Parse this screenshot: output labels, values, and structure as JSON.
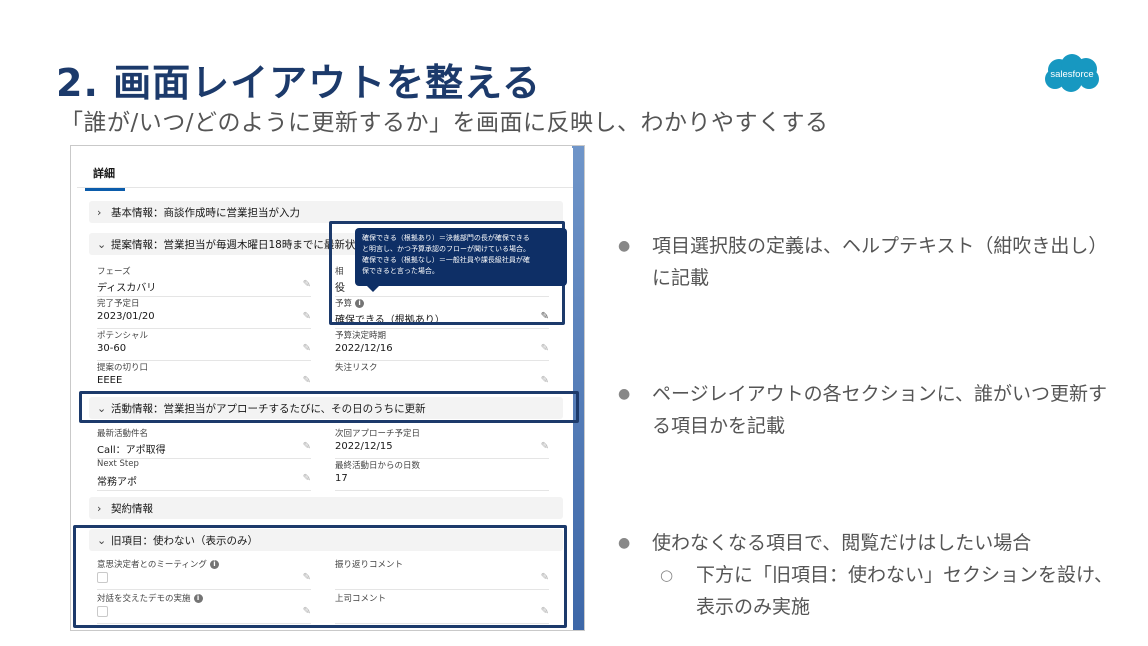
{
  "slide": {
    "title": "2. 画面レイアウトを整える",
    "subtitle": "「誰が/いつ/どのように更新するか」を画面に反映し、わかりやすくする",
    "logo_text": "salesforce"
  },
  "screen": {
    "tab": "詳細",
    "sections": {
      "basic": "基本情報：商談作成時に営業担当が入力",
      "proposal": "提案情報：営業担当が毎週木曜日18時までに最新状",
      "activity": "活動情報：営業担当がアプローチするたびに、その日のうちに更新",
      "contract": "契約情報",
      "legacy": "旧項目：使わない（表示のみ）"
    },
    "proposal_fields": [
      {
        "label": "フェーズ",
        "value": "ディスカバリ"
      },
      {
        "label": "相",
        "value": "役"
      },
      {
        "label": "完了予定日",
        "value": "2023/01/20"
      },
      {
        "label": "予算",
        "value": "確保できる（根拠あり）"
      },
      {
        "label": "ポテンシャル",
        "value": "30-60"
      },
      {
        "label": "予算決定時期",
        "value": "2022/12/16"
      },
      {
        "label": "提案の切り口",
        "value": "EEEE"
      },
      {
        "label": "失注リスク",
        "value": ""
      }
    ],
    "activity_fields": [
      {
        "label": "最新活動件名",
        "value": "Call：アポ取得"
      },
      {
        "label": "次回アプローチ予定日",
        "value": "2022/12/15"
      },
      {
        "label": "Next Step",
        "value": "常務アポ"
      },
      {
        "label": "最終活動日からの日数",
        "value": "17"
      }
    ],
    "legacy_fields": [
      {
        "label": "意思決定者とのミーティング"
      },
      {
        "label": "振り返りコメント"
      },
      {
        "label": "対話を交えたデモの実施"
      },
      {
        "label": "上司コメント"
      }
    ],
    "tooltip": {
      "line1": "確保できる（根拠あり）＝決裁部門の長が確保できる",
      "line2": "と明言し、かつ予算承認のフローが聞けている場合。",
      "line3": "確保できる（根拠なし）＝一般社員や課長級社員が確",
      "line4": "保できると言った場合。"
    }
  },
  "bullets": [
    {
      "text": "項目選択肢の定義は、ヘルプテキスト（紺吹き出し）に記載"
    },
    {
      "text": "ページレイアウトの各セクションに、誰がいつ更新する項目かを記載"
    },
    {
      "text": "使わなくなる項目で、閲覧だけはしたい場合"
    }
  ],
  "sub_bullet": {
    "text": "下方に「旧項目：使わない」セクションを設け、表示のみ実施"
  }
}
